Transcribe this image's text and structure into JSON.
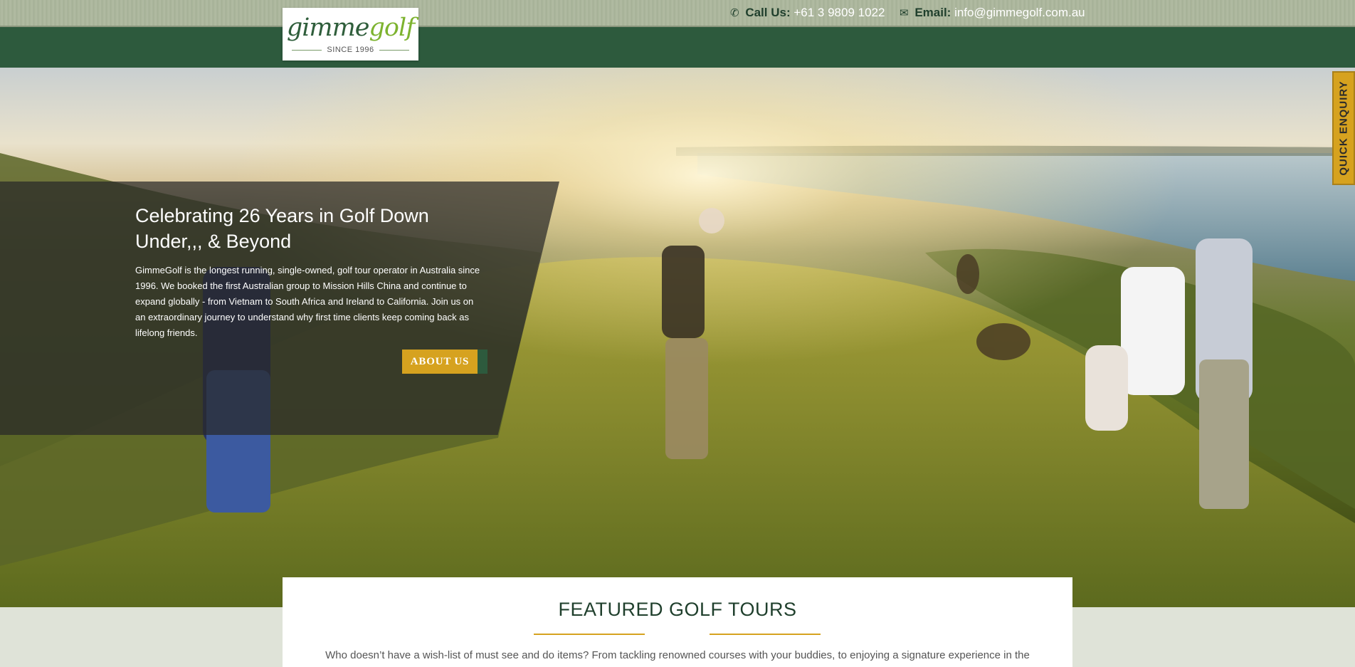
{
  "header": {
    "phone_label": "Call Us:",
    "phone_value": "+61 3 9809 1022",
    "email_label": "Email:",
    "email_value": "info@gimmegolf.com.au",
    "phone_icon": "phone-icon",
    "email_icon": "envelope-icon"
  },
  "logo": {
    "part1": "gimme",
    "part2": "golf",
    "since": "SINCE 1996"
  },
  "hero": {
    "title": "Celebrating 26 Years in Golf Down Under,,, & Beyond",
    "description": "GimmeGolf is the longest running, single-owned, golf tour operator in Australia since 1996. We booked the first Australian group to Mission Hills China and continue to expand globally - from Vietnam to South Africa and Ireland to California. Join us on an extraordinary journey to understand why first time clients keep coming back as lifelong friends.",
    "button_label": "ABOUT US"
  },
  "quick_enquiry": {
    "label": "QUICK ENQUIRY"
  },
  "featured": {
    "title": "FEATURED GOLF TOURS",
    "intro": "Who doesn’t have a wish-list of must see and do items? From tackling renowned courses with your buddies, to enjoying a signature experience in the"
  },
  "colors": {
    "brand_green": "#2d5a3d",
    "accent_gold": "#d6a21f",
    "logo_light_green": "#7db32f"
  }
}
